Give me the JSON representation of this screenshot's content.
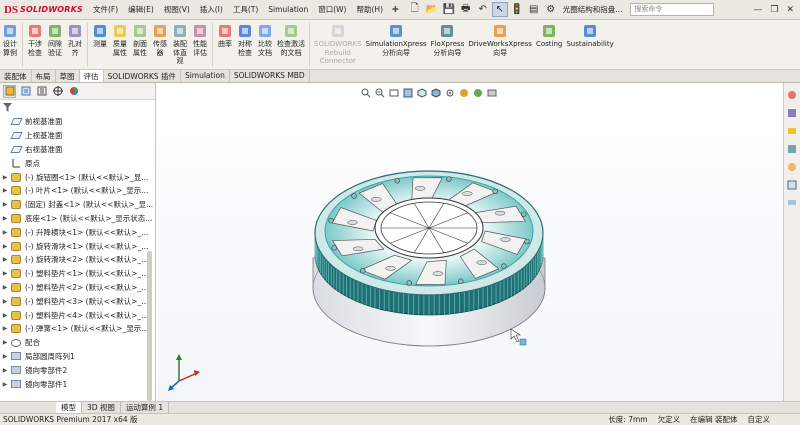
{
  "app": {
    "logo_mark": "DS",
    "logo_text": "SOLIDWORKS",
    "menu": [
      "文件(F)",
      "编辑(E)",
      "视图(V)",
      "插入(I)",
      "工具(T)",
      "Simulation",
      "窗口(W)",
      "帮助(H)"
    ],
    "doc_title": "光圈结构和指盘...",
    "search_placeholder": "搜索命令"
  },
  "ribbon": {
    "items": [
      {
        "label": "设计\n算例",
        "icon": "design-study-icon",
        "dim": false
      },
      {
        "label": "干涉\n检查",
        "icon": "interference-check-icon",
        "dim": false
      },
      {
        "label": "间隙\n验证",
        "icon": "clearance-verify-icon",
        "dim": false
      },
      {
        "label": "孔对\n齐",
        "icon": "hole-align-icon",
        "dim": false
      },
      {
        "label": "测量",
        "icon": "measure-icon",
        "dim": false
      },
      {
        "label": "质量\n属性",
        "icon": "mass-properties-icon",
        "dim": false
      },
      {
        "label": "剖面\n属性",
        "icon": "section-properties-icon",
        "dim": false
      },
      {
        "label": "传感\n器",
        "icon": "sensor-icon",
        "dim": false
      },
      {
        "label": "装配\n体直\n观",
        "icon": "assembly-visualization-icon",
        "dim": false
      },
      {
        "label": "性能\n评估",
        "icon": "performance-evaluation-icon",
        "dim": false
      },
      {
        "label": "曲率",
        "icon": "curvature-icon",
        "dim": false
      },
      {
        "label": "对称\n检查",
        "icon": "symmetry-check-icon",
        "dim": false
      },
      {
        "label": "比较\n文档",
        "icon": "compare-documents-icon",
        "dim": false
      },
      {
        "label": "检查激活\n的文档",
        "icon": "check-active-document-icon",
        "dim": false
      },
      {
        "label": "SOLIDWORKS\nRebuild\nConnector",
        "icon": "rebuild-connector-icon",
        "dim": true
      },
      {
        "label": "SimulationXpress\n分析向导",
        "icon": "simulationxpress-icon",
        "dim": false
      },
      {
        "label": "FloXpress\n分析向导",
        "icon": "floxpress-icon",
        "dim": false
      },
      {
        "label": "DriveWorksXpress\n向导",
        "icon": "driveworksxpress-icon",
        "dim": false
      },
      {
        "label": "Costing",
        "icon": "costing-icon",
        "dim": false
      },
      {
        "label": "Sustainability",
        "icon": "sustainability-icon",
        "dim": false
      }
    ]
  },
  "command_tabs": [
    "装配体",
    "布局",
    "草图",
    "评估",
    "SOLIDWORKS 插件",
    "Simulation",
    "SOLIDWORKS MBD"
  ],
  "active_command_tab": 3,
  "tree": [
    {
      "arrow": "",
      "icon": "plane",
      "label": "前视基准面"
    },
    {
      "arrow": "",
      "icon": "plane",
      "label": "上视基准面"
    },
    {
      "arrow": "",
      "icon": "plane",
      "label": "右视基准面"
    },
    {
      "arrow": "",
      "icon": "origin",
      "label": "原点"
    },
    {
      "arrow": "▶",
      "icon": "part",
      "label": "(-) 旋钮圈<1> (默认<<默认>_显..."
    },
    {
      "arrow": "▶",
      "icon": "part",
      "label": "(-) 叶片<1> (默认<<默认>_显示..."
    },
    {
      "arrow": "▶",
      "icon": "part",
      "label": "(固定) 封盖<1> (默认<<默认>_显..."
    },
    {
      "arrow": "▶",
      "icon": "part",
      "label": "底座<1> (默认<<默认>_显示状态..."
    },
    {
      "arrow": "▶",
      "icon": "part",
      "label": "(-) 升降横块<1> (默认<<默认>_..."
    },
    {
      "arrow": "▶",
      "icon": "part",
      "label": "(-) 旋转滑块<1> (默认<<默认>_..."
    },
    {
      "arrow": "▶",
      "icon": "part",
      "label": "(-) 旋转滑块<2> (默认<<默认>_..."
    },
    {
      "arrow": "▶",
      "icon": "part",
      "label": "(-) 塑料垫片<1> (默认<<默认>_..."
    },
    {
      "arrow": "▶",
      "icon": "part",
      "label": "(-) 塑料垫片<2> (默认<<默认>_..."
    },
    {
      "arrow": "▶",
      "icon": "part",
      "label": "(-) 塑料垫片<3> (默认<<默认>_..."
    },
    {
      "arrow": "▶",
      "icon": "part",
      "label": "(-) 塑料垫片<4> (默认<<默认>_..."
    },
    {
      "arrow": "▶",
      "icon": "part",
      "label": "(-) 弹簧<1> (默认<<默认>_显示..."
    },
    {
      "arrow": "▶",
      "icon": "mate",
      "label": "配合"
    },
    {
      "arrow": "▶",
      "icon": "mirror",
      "label": "局部圆周阵列1"
    },
    {
      "arrow": "▶",
      "icon": "mirror",
      "label": "镜向零部件2"
    },
    {
      "arrow": "▶",
      "icon": "mirror",
      "label": "镜向零部件1"
    }
  ],
  "model_tabs": [
    "模型",
    "3D 视图",
    "运动算例 1"
  ],
  "status": {
    "left": "SOLIDWORKS Premium 2017 x64 版",
    "length": "长度: 7mm",
    "undefined": "欠定义",
    "editing": "在编辑 装配体",
    "custom": "自定义"
  },
  "colors": {
    "accent_teal": "#3aa5a6",
    "dark_teal": "#1f6f73",
    "brand_red": "#c8102e"
  }
}
